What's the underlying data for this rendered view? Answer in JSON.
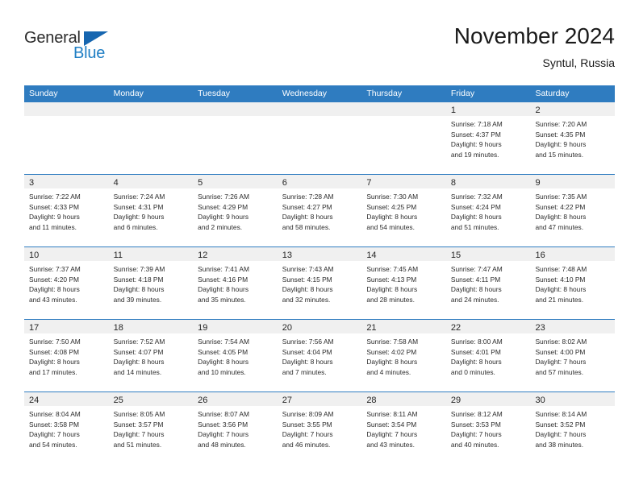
{
  "brand": {
    "name_part1": "General",
    "name_part2": "Blue",
    "accent_color": "#1f7ec4",
    "triangle_color": "#1666b0",
    "triangle_icon": "triangle-icon"
  },
  "header": {
    "month_title": "November 2024",
    "location": "Syntul, Russia"
  },
  "calendar": {
    "header_bg": "#2f7cc0",
    "day_band_bg": "#f0f0f0",
    "weekdays": [
      "Sunday",
      "Monday",
      "Tuesday",
      "Wednesday",
      "Thursday",
      "Friday",
      "Saturday"
    ],
    "weeks": [
      [
        {
          "day": "",
          "sunrise": "",
          "sunset": "",
          "daylight_line1": "",
          "daylight_line2": ""
        },
        {
          "day": "",
          "sunrise": "",
          "sunset": "",
          "daylight_line1": "",
          "daylight_line2": ""
        },
        {
          "day": "",
          "sunrise": "",
          "sunset": "",
          "daylight_line1": "",
          "daylight_line2": ""
        },
        {
          "day": "",
          "sunrise": "",
          "sunset": "",
          "daylight_line1": "",
          "daylight_line2": ""
        },
        {
          "day": "",
          "sunrise": "",
          "sunset": "",
          "daylight_line1": "",
          "daylight_line2": ""
        },
        {
          "day": "1",
          "sunrise": "Sunrise: 7:18 AM",
          "sunset": "Sunset: 4:37 PM",
          "daylight_line1": "Daylight: 9 hours",
          "daylight_line2": "and 19 minutes."
        },
        {
          "day": "2",
          "sunrise": "Sunrise: 7:20 AM",
          "sunset": "Sunset: 4:35 PM",
          "daylight_line1": "Daylight: 9 hours",
          "daylight_line2": "and 15 minutes."
        }
      ],
      [
        {
          "day": "3",
          "sunrise": "Sunrise: 7:22 AM",
          "sunset": "Sunset: 4:33 PM",
          "daylight_line1": "Daylight: 9 hours",
          "daylight_line2": "and 11 minutes."
        },
        {
          "day": "4",
          "sunrise": "Sunrise: 7:24 AM",
          "sunset": "Sunset: 4:31 PM",
          "daylight_line1": "Daylight: 9 hours",
          "daylight_line2": "and 6 minutes."
        },
        {
          "day": "5",
          "sunrise": "Sunrise: 7:26 AM",
          "sunset": "Sunset: 4:29 PM",
          "daylight_line1": "Daylight: 9 hours",
          "daylight_line2": "and 2 minutes."
        },
        {
          "day": "6",
          "sunrise": "Sunrise: 7:28 AM",
          "sunset": "Sunset: 4:27 PM",
          "daylight_line1": "Daylight: 8 hours",
          "daylight_line2": "and 58 minutes."
        },
        {
          "day": "7",
          "sunrise": "Sunrise: 7:30 AM",
          "sunset": "Sunset: 4:25 PM",
          "daylight_line1": "Daylight: 8 hours",
          "daylight_line2": "and 54 minutes."
        },
        {
          "day": "8",
          "sunrise": "Sunrise: 7:32 AM",
          "sunset": "Sunset: 4:24 PM",
          "daylight_line1": "Daylight: 8 hours",
          "daylight_line2": "and 51 minutes."
        },
        {
          "day": "9",
          "sunrise": "Sunrise: 7:35 AM",
          "sunset": "Sunset: 4:22 PM",
          "daylight_line1": "Daylight: 8 hours",
          "daylight_line2": "and 47 minutes."
        }
      ],
      [
        {
          "day": "10",
          "sunrise": "Sunrise: 7:37 AM",
          "sunset": "Sunset: 4:20 PM",
          "daylight_line1": "Daylight: 8 hours",
          "daylight_line2": "and 43 minutes."
        },
        {
          "day": "11",
          "sunrise": "Sunrise: 7:39 AM",
          "sunset": "Sunset: 4:18 PM",
          "daylight_line1": "Daylight: 8 hours",
          "daylight_line2": "and 39 minutes."
        },
        {
          "day": "12",
          "sunrise": "Sunrise: 7:41 AM",
          "sunset": "Sunset: 4:16 PM",
          "daylight_line1": "Daylight: 8 hours",
          "daylight_line2": "and 35 minutes."
        },
        {
          "day": "13",
          "sunrise": "Sunrise: 7:43 AM",
          "sunset": "Sunset: 4:15 PM",
          "daylight_line1": "Daylight: 8 hours",
          "daylight_line2": "and 32 minutes."
        },
        {
          "day": "14",
          "sunrise": "Sunrise: 7:45 AM",
          "sunset": "Sunset: 4:13 PM",
          "daylight_line1": "Daylight: 8 hours",
          "daylight_line2": "and 28 minutes."
        },
        {
          "day": "15",
          "sunrise": "Sunrise: 7:47 AM",
          "sunset": "Sunset: 4:11 PM",
          "daylight_line1": "Daylight: 8 hours",
          "daylight_line2": "and 24 minutes."
        },
        {
          "day": "16",
          "sunrise": "Sunrise: 7:48 AM",
          "sunset": "Sunset: 4:10 PM",
          "daylight_line1": "Daylight: 8 hours",
          "daylight_line2": "and 21 minutes."
        }
      ],
      [
        {
          "day": "17",
          "sunrise": "Sunrise: 7:50 AM",
          "sunset": "Sunset: 4:08 PM",
          "daylight_line1": "Daylight: 8 hours",
          "daylight_line2": "and 17 minutes."
        },
        {
          "day": "18",
          "sunrise": "Sunrise: 7:52 AM",
          "sunset": "Sunset: 4:07 PM",
          "daylight_line1": "Daylight: 8 hours",
          "daylight_line2": "and 14 minutes."
        },
        {
          "day": "19",
          "sunrise": "Sunrise: 7:54 AM",
          "sunset": "Sunset: 4:05 PM",
          "daylight_line1": "Daylight: 8 hours",
          "daylight_line2": "and 10 minutes."
        },
        {
          "day": "20",
          "sunrise": "Sunrise: 7:56 AM",
          "sunset": "Sunset: 4:04 PM",
          "daylight_line1": "Daylight: 8 hours",
          "daylight_line2": "and 7 minutes."
        },
        {
          "day": "21",
          "sunrise": "Sunrise: 7:58 AM",
          "sunset": "Sunset: 4:02 PM",
          "daylight_line1": "Daylight: 8 hours",
          "daylight_line2": "and 4 minutes."
        },
        {
          "day": "22",
          "sunrise": "Sunrise: 8:00 AM",
          "sunset": "Sunset: 4:01 PM",
          "daylight_line1": "Daylight: 8 hours",
          "daylight_line2": "and 0 minutes."
        },
        {
          "day": "23",
          "sunrise": "Sunrise: 8:02 AM",
          "sunset": "Sunset: 4:00 PM",
          "daylight_line1": "Daylight: 7 hours",
          "daylight_line2": "and 57 minutes."
        }
      ],
      [
        {
          "day": "24",
          "sunrise": "Sunrise: 8:04 AM",
          "sunset": "Sunset: 3:58 PM",
          "daylight_line1": "Daylight: 7 hours",
          "daylight_line2": "and 54 minutes."
        },
        {
          "day": "25",
          "sunrise": "Sunrise: 8:05 AM",
          "sunset": "Sunset: 3:57 PM",
          "daylight_line1": "Daylight: 7 hours",
          "daylight_line2": "and 51 minutes."
        },
        {
          "day": "26",
          "sunrise": "Sunrise: 8:07 AM",
          "sunset": "Sunset: 3:56 PM",
          "daylight_line1": "Daylight: 7 hours",
          "daylight_line2": "and 48 minutes."
        },
        {
          "day": "27",
          "sunrise": "Sunrise: 8:09 AM",
          "sunset": "Sunset: 3:55 PM",
          "daylight_line1": "Daylight: 7 hours",
          "daylight_line2": "and 46 minutes."
        },
        {
          "day": "28",
          "sunrise": "Sunrise: 8:11 AM",
          "sunset": "Sunset: 3:54 PM",
          "daylight_line1": "Daylight: 7 hours",
          "daylight_line2": "and 43 minutes."
        },
        {
          "day": "29",
          "sunrise": "Sunrise: 8:12 AM",
          "sunset": "Sunset: 3:53 PM",
          "daylight_line1": "Daylight: 7 hours",
          "daylight_line2": "and 40 minutes."
        },
        {
          "day": "30",
          "sunrise": "Sunrise: 8:14 AM",
          "sunset": "Sunset: 3:52 PM",
          "daylight_line1": "Daylight: 7 hours",
          "daylight_line2": "and 38 minutes."
        }
      ]
    ]
  }
}
